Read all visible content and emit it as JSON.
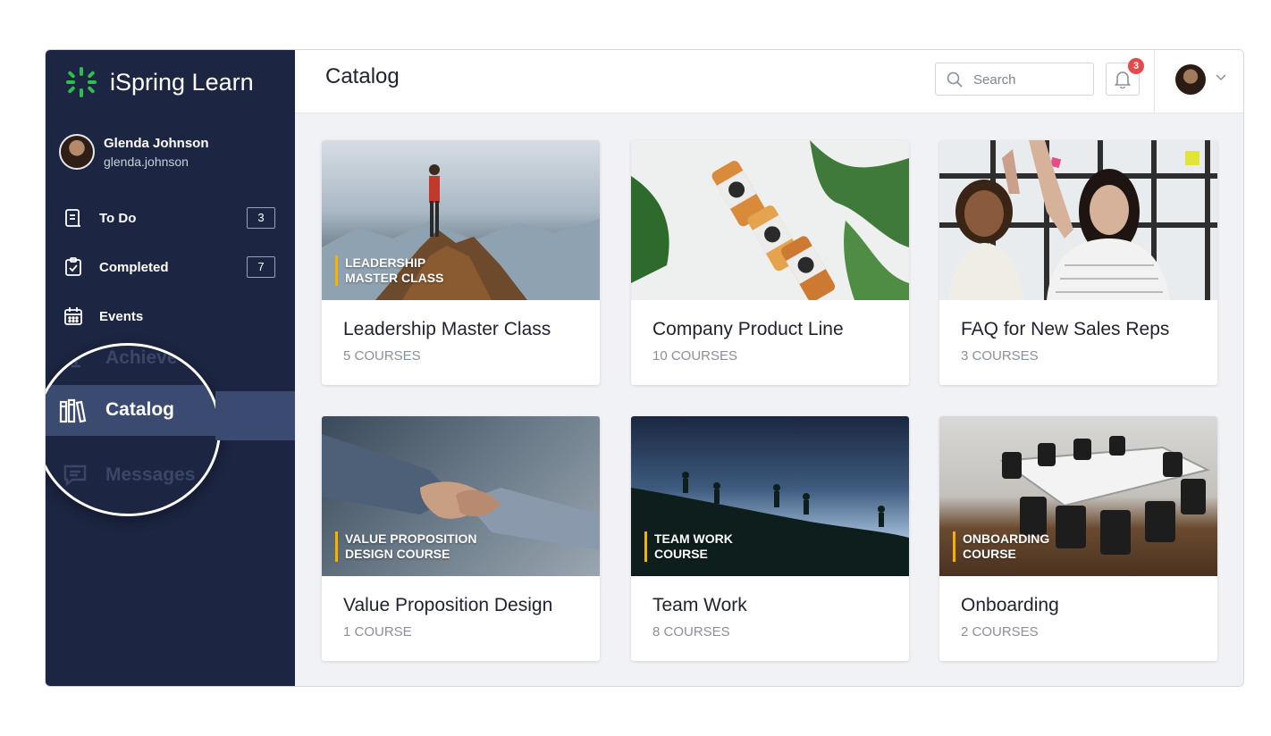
{
  "app": {
    "name": "iSpring Learn",
    "brand_color": "#2fbf4f"
  },
  "user": {
    "name": "Glenda Johnson",
    "login": "glenda.johnson"
  },
  "sidebar": {
    "items": [
      {
        "label": "To Do",
        "count": "3",
        "icon": "todo-list-icon"
      },
      {
        "label": "Completed",
        "count": "7",
        "icon": "completed-clipboard-icon"
      },
      {
        "label": "Events",
        "icon": "calendar-icon"
      }
    ],
    "zoom": {
      "above_label": "Achievements",
      "above_visible": "Achieve",
      "active_label": "Catalog",
      "below_label": "Messages"
    }
  },
  "header": {
    "title": "Catalog",
    "search_placeholder": "Search",
    "notification_count": "3"
  },
  "cards": [
    {
      "title": "Leadership Master Class",
      "sub": "5 COURSES",
      "tag": [
        "LEADERSHIP",
        "MASTER CLASS"
      ]
    },
    {
      "title": "Company Product Line",
      "sub": "10 COURSES",
      "tag": []
    },
    {
      "title": "FAQ for New Sales Reps",
      "sub": "3 COURSES",
      "tag": []
    },
    {
      "title": "Value Proposition Design",
      "sub": "1 COURSE",
      "tag": [
        "VALUE PROPOSITION",
        "DESIGN COURSE"
      ]
    },
    {
      "title": "Team Work",
      "sub": "8 COURSES",
      "tag": [
        "TEAM WORK",
        "COURSE"
      ]
    },
    {
      "title": "Onboarding",
      "sub": "2 COURSES",
      "tag": [
        "ONBOARDING",
        "COURSE"
      ]
    }
  ]
}
